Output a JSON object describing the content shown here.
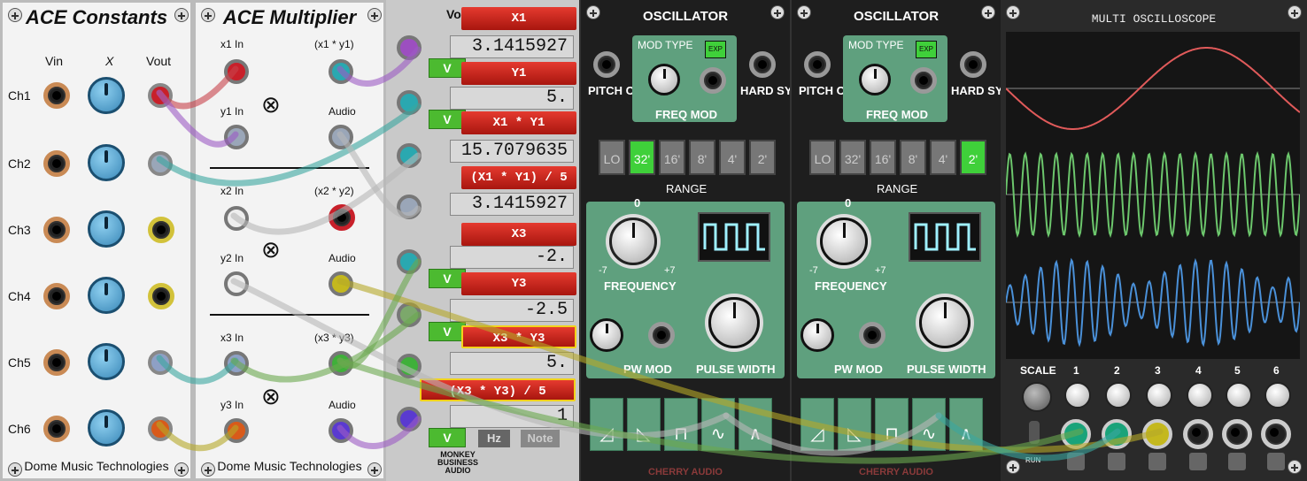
{
  "constants": {
    "title": "ACE Constants",
    "columns": {
      "vin": "Vin",
      "x": "X",
      "vout": "Vout"
    },
    "rows": [
      "Ch1",
      "Ch2",
      "Ch3",
      "Ch4",
      "Ch5",
      "Ch6"
    ],
    "footer": "Dome Music Technologies"
  },
  "multiplier": {
    "title": "ACE Multiplier",
    "labels": {
      "x1": "x1 In",
      "y1": "y1 In",
      "out1": "(x1 * y1)",
      "audio1": "Audio",
      "x2": "x2 In",
      "y2": "y2 In",
      "out2": "(x2 * y2)",
      "audio2": "Audio",
      "x3": "x3 In",
      "y3": "y3 In",
      "out3": "(x3 * y3)",
      "audio3": "Audio"
    },
    "footer": "Dome Music Technologies"
  },
  "vo": {
    "header": "Vo",
    "buttons": [
      "X1",
      "Y1",
      "X1 * Y1",
      "(X1 * Y1) / 5",
      "X3",
      "Y3",
      "X3 * Y3",
      "(X3 * Y3) / 5"
    ],
    "displays": [
      "3.1415927",
      "5.",
      "15.7079635",
      "3.1415927",
      "-2.",
      "-2.5",
      "5.",
      "1"
    ],
    "v_label": "V",
    "hz_label": "Hz",
    "note_label": "Note",
    "brand_lines": [
      "MONKEY",
      "BUSINESS",
      "AUDIO"
    ]
  },
  "osc1": {
    "title": "OSCILLATOR",
    "pitch_cv": "PITCH CV",
    "hard_sync": "HARD SYNC",
    "mod_type": "MOD TYPE",
    "exp": "EXP",
    "freq_mod": "FREQ MOD",
    "range": "RANGE",
    "range_options": [
      "LO",
      "32'",
      "16'",
      "8'",
      "4'",
      "2'"
    ],
    "range_selected": "32'",
    "frequency": "FREQUENCY",
    "freq_min": "-7",
    "freq_max": "+7",
    "freq_zero": "0",
    "pw_mod": "PW MOD",
    "pulse_width": "PULSE WIDTH",
    "brand": "CHERRY AUDIO"
  },
  "osc2": {
    "title": "OSCILLATOR",
    "pitch_cv": "PITCH CV",
    "hard_sync": "HARD SYNC",
    "mod_type": "MOD TYPE",
    "exp": "EXP",
    "freq_mod": "FREQ MOD",
    "range": "RANGE",
    "range_options": [
      "LO",
      "32'",
      "16'",
      "8'",
      "4'",
      "2'"
    ],
    "range_selected": "2'",
    "frequency": "FREQUENCY",
    "freq_min": "-7",
    "freq_max": "+7",
    "freq_zero": "0",
    "pw_mod": "PW MOD",
    "pulse_width": "PULSE WIDTH",
    "brand": "CHERRY AUDIO"
  },
  "scope": {
    "title": "MULTI OSCILLOSCOPE",
    "scale": "SCALE",
    "channels": [
      "1",
      "2",
      "3",
      "4",
      "5",
      "6"
    ],
    "run": "RUN",
    "trace_colors": [
      "#e05a5a",
      "#6cc66c",
      "#4a90d8"
    ]
  },
  "cable_colors": {
    "red": "#c8434b",
    "teal": "#3aa7a0",
    "purple": "#9c5bc5",
    "yellow": "#b5a928",
    "grey": "#b8b8b8",
    "green": "#6aa84f"
  }
}
